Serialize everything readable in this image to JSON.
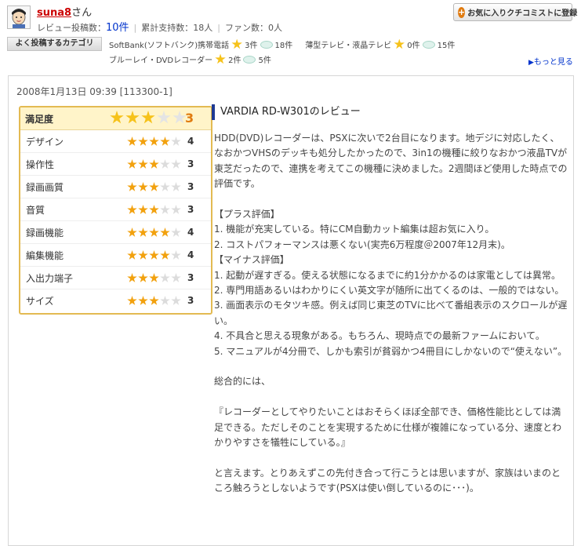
{
  "user": {
    "name": "suna8",
    "suffix": "さん",
    "review_count_label": "レビュー投稿数：",
    "review_count": "10件",
    "support_label": "累計支持数：",
    "support_count": "18人",
    "fans_label": "ファン数：",
    "fans_count": "0人"
  },
  "favorite_button": {
    "label": "お気に入りクチコミストに登録",
    "icon": "plus-icon"
  },
  "categories": {
    "label": "よく投稿するカテゴリ",
    "items": [
      {
        "name": "SoftBank(ソフトバンク)携帯電話",
        "stars": "3件",
        "comments": "18件"
      },
      {
        "name": "薄型テレビ・液晶テレビ",
        "stars": "0件",
        "comments": "15件"
      },
      {
        "name": "ブルーレイ・DVDレコーダー",
        "stars": "2件",
        "comments": "5件"
      }
    ],
    "more_label": "もっと見る"
  },
  "review": {
    "date": "2008年1月13日 09:39 [113300-1]",
    "title": "VARDIA RD-W301のレビュー",
    "overall": {
      "label": "満足度",
      "score": "3",
      "stars": 3
    },
    "ratings": [
      {
        "label": "デザイン",
        "score": "4",
        "stars": 4
      },
      {
        "label": "操作性",
        "score": "3",
        "stars": 3
      },
      {
        "label": "録画画質",
        "score": "3",
        "stars": 3
      },
      {
        "label": "音質",
        "score": "3",
        "stars": 3
      },
      {
        "label": "録画機能",
        "score": "4",
        "stars": 4
      },
      {
        "label": "編集機能",
        "score": "4",
        "stars": 4
      },
      {
        "label": "入出力端子",
        "score": "3",
        "stars": 3
      },
      {
        "label": "サイズ",
        "score": "3",
        "stars": 3
      }
    ],
    "body": [
      "HDD(DVD)レコーダーは、PSXに次いで2台目になります。地デジに対応したく、なおかつVHSのデッキも処分したかったので、3in1の機種に絞りなおかつ液晶TVが東芝だったので、連携を考えてこの機種に決めました。2週間ほど使用した時点での評価です。",
      "",
      "【プラス評価】",
      "1. 機能が充実している。特にCM自動カット編集は超お気に入り。",
      "2. コストパフォーマンスは悪くない(実売6万程度＠2007年12月末)。",
      "【マイナス評価】",
      "1. 起動が遅すぎる。使える状態になるまでに約1分かかるのは家電としては異常。",
      "2. 専門用語あるいはわかりにくい英文字が随所に出てくるのは、一般的ではない。",
      "3. 画面表示のモタツキ感。例えば同じ東芝のTVに比べて番組表示のスクロールが遅い。",
      "4. 不具合と思える現象がある。もちろん、現時点での最新ファームにおいて。",
      "5. マニュアルが4分冊で、しかも索引が貧弱かつ4冊目にしかないので“使えない”。",
      "",
      "総合的には、",
      "",
      "『レコーダーとしてやりたいことはおそらくほぼ全部でき、価格性能比としては満足できる。ただしそのことを実現するために仕様が複雑になっている分、速度とわかりやすさを犠牲にしている。』",
      "",
      "と言えます。とりあえずこの先付き合って行こうとは思いますが、家族はいまのところ触ろうとしないようです(PSXは使い倒しているのに･･･)。"
    ]
  }
}
